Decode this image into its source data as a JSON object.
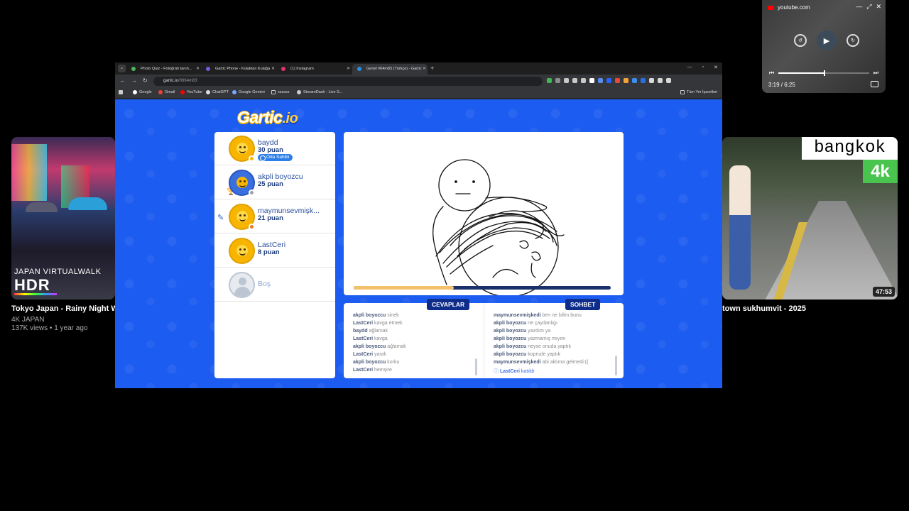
{
  "youtube": {
    "left_card": {
      "thumb_text_small": "JAPAN VIRTUALWALK",
      "thumb_text_big": "HDR",
      "title": "Tokyo Japan - Rainy Night Wa",
      "channel": "4K JAPAN",
      "meta": "137K views • 1 year ago"
    },
    "right_card": {
      "thumb_text_big": "bangkok",
      "thumb_text_quality": "4k",
      "duration": "47:53",
      "title": "town sukhumvit - 2025"
    },
    "mini_player": {
      "site": "youtube.com",
      "time": "3:19 / 6:25",
      "progress_fraction": 0.5
    }
  },
  "browser": {
    "tabs": [
      {
        "label": "Photo Quiz - Fotoğrafı tanıh...",
        "active": false
      },
      {
        "label": "Gartic Phone - Kulaktan Kulağa",
        "active": false
      },
      {
        "label": "(1) Instagram",
        "active": false
      },
      {
        "label": "Genel #64m83 (Türkçe) - Gartic",
        "active": true
      }
    ],
    "url_host": "gartic.io",
    "url_path": "/0664m83",
    "bookmarks": [
      "Google",
      "Gmail",
      "YouTube",
      "ChatGPT",
      "Google Gemini",
      "ssssss",
      "StreamDash - Live S..."
    ],
    "bookmarks_other": "Tüm Yer İşaretleri"
  },
  "gartic": {
    "logo": "Gartic",
    "logo_suffix": ".io",
    "players": [
      {
        "name": "baydd",
        "score": "30 puan",
        "badge": "Oda Sahibi",
        "status_color": "#f7b500"
      },
      {
        "name": "akpli boyozcu",
        "score": "25 puan",
        "status_color": "#a0a0a0"
      },
      {
        "name": "maymunsevmişk...",
        "score": "21 puan",
        "status_color": "#e07a20"
      },
      {
        "name": "LastCeri",
        "score": "8 puan"
      },
      {
        "name": "Boş",
        "score": ""
      }
    ],
    "timer_fraction": 0.39,
    "answers_label": "CEVAPLAR",
    "chat_label": "SOHBET",
    "answers": [
      {
        "user": "akpli boyozcu",
        "text": "sinek"
      },
      {
        "user": "LastCeri",
        "text": "kavga etmek"
      },
      {
        "user": "baydd",
        "text": "ağlamak"
      },
      {
        "user": "LastCeri",
        "text": "kavga"
      },
      {
        "user": "akpli boyozcu",
        "text": "ağlamak"
      },
      {
        "user": "LastCeri",
        "text": "yaralı"
      },
      {
        "user": "akpli boyozcu",
        "text": "korku"
      },
      {
        "user": "LastCeri",
        "text": "hemşire"
      }
    ],
    "chat": [
      {
        "user": "maymunsevmişkedi",
        "text": "ben ne bilim bunu"
      },
      {
        "user": "akpli boyozcu",
        "text": "ne çaydanlıgı"
      },
      {
        "user": "akpli boyozcu",
        "text": "yazdım ya"
      },
      {
        "user": "akpli boyozcu",
        "text": "yazmamış mıyım"
      },
      {
        "user": "akpli boyozcu",
        "text": "neyse onuda yaptık"
      },
      {
        "user": "akpli boyozcu",
        "text": "koprude yaptık"
      },
      {
        "user": "maymunsevmişkedi",
        "text": "abi aklıma gelmedi:(("
      },
      {
        "user": "LastCeri",
        "text": "katıldı",
        "join": true
      }
    ]
  }
}
